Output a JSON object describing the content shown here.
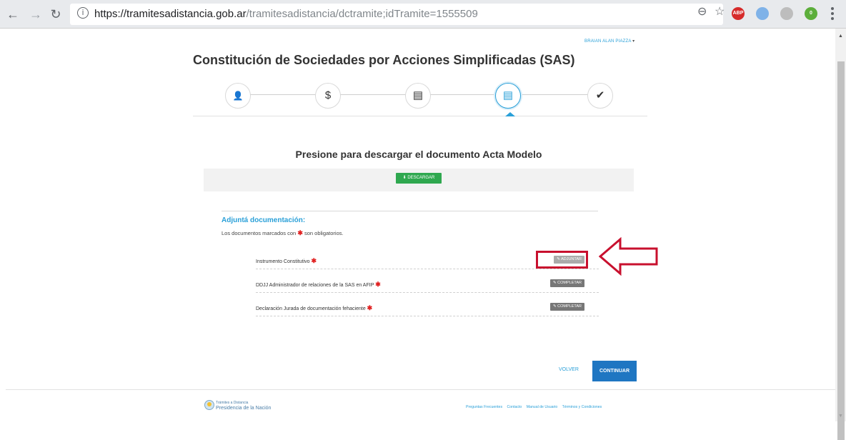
{
  "browser": {
    "url_host": "https://tramitesadistancia.gob.ar",
    "url_path": "/tramitesadistancia/dctramite;idTramite=1555509",
    "extensions": [
      {
        "name": "adblock-plus",
        "label": "ABP",
        "color": "#d62b2b"
      },
      {
        "name": "sync-extension",
        "label": "",
        "color": "#7fb2e8"
      },
      {
        "name": "screenshot-extension",
        "label": "",
        "color": "#bdbdbd"
      },
      {
        "name": "green-extension",
        "label": "0",
        "color": "#5cae3b"
      }
    ]
  },
  "header": {
    "user_name": "BRAIAN ALAN PIAZZA",
    "user_caret": "▾",
    "page_title": "Constitución de Sociedades por Acciones Simplificadas (SAS)"
  },
  "stepper": {
    "steps": [
      {
        "icon": "user-icon",
        "glyph": "👤"
      },
      {
        "icon": "dollar-icon",
        "glyph": "$"
      },
      {
        "icon": "form-icon",
        "glyph": "▤"
      },
      {
        "icon": "form-icon",
        "glyph": "▤",
        "active": true
      },
      {
        "icon": "check-icon",
        "glyph": "✔"
      }
    ]
  },
  "download": {
    "heading": "Presione para descargar el documento Acta Modelo",
    "button_label": "⬇ DESCARGAR"
  },
  "documents": {
    "title": "Adjuntá documentación:",
    "subtitle_before": "Los documentos marcados con",
    "required_mark": "✱",
    "subtitle_after": "son obligatorios.",
    "items": [
      {
        "label": "Instrumento Constitutivo",
        "button": "✎ ADJUNTAR"
      },
      {
        "label": "DDJJ Administrador de relaciones de la SAS en AFIP",
        "button": "✎ COMPLETAR"
      },
      {
        "label": "Declaración Jurada de documentación fehaciente",
        "button": "✎ COMPLETAR"
      }
    ]
  },
  "actions": {
    "back_label": "VOLVER",
    "continue_label": "CONTINUAR"
  },
  "footer": {
    "brand_line1": "Trámites a Distancia",
    "brand_line2": "Presidencia de la Nación",
    "links": [
      "Preguntas Frecuentes",
      "Contacto",
      "Manual de Usuario",
      "Términos y Condiciones"
    ]
  },
  "colors": {
    "accent": "#2aa0d8",
    "primary_button": "#1f76c2",
    "download_button": "#2fa84f",
    "required": "#e02020",
    "annotation": "#c8102e"
  }
}
